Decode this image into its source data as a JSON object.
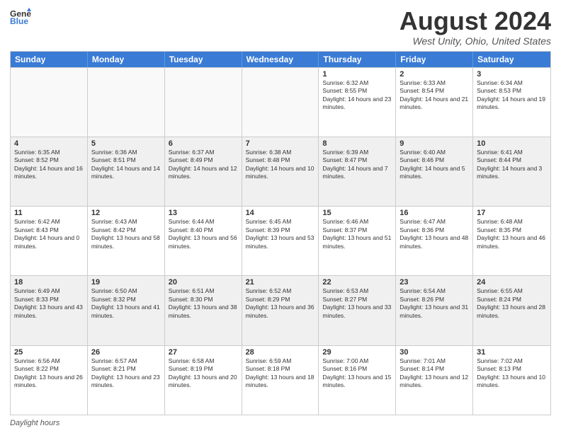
{
  "header": {
    "logo_line1": "General",
    "logo_line2": "Blue",
    "month_title": "August 2024",
    "location": "West Unity, Ohio, United States"
  },
  "weekdays": [
    "Sunday",
    "Monday",
    "Tuesday",
    "Wednesday",
    "Thursday",
    "Friday",
    "Saturday"
  ],
  "footer": {
    "label": "Daylight hours"
  },
  "weeks": [
    [
      {
        "day": "",
        "sunrise": "",
        "sunset": "",
        "daylight": "",
        "empty": true
      },
      {
        "day": "",
        "sunrise": "",
        "sunset": "",
        "daylight": "",
        "empty": true
      },
      {
        "day": "",
        "sunrise": "",
        "sunset": "",
        "daylight": "",
        "empty": true
      },
      {
        "day": "",
        "sunrise": "",
        "sunset": "",
        "daylight": "",
        "empty": true
      },
      {
        "day": "1",
        "sunrise": "Sunrise: 6:32 AM",
        "sunset": "Sunset: 8:55 PM",
        "daylight": "Daylight: 14 hours and 23 minutes."
      },
      {
        "day": "2",
        "sunrise": "Sunrise: 6:33 AM",
        "sunset": "Sunset: 8:54 PM",
        "daylight": "Daylight: 14 hours and 21 minutes."
      },
      {
        "day": "3",
        "sunrise": "Sunrise: 6:34 AM",
        "sunset": "Sunset: 8:53 PM",
        "daylight": "Daylight: 14 hours and 19 minutes."
      }
    ],
    [
      {
        "day": "4",
        "sunrise": "Sunrise: 6:35 AM",
        "sunset": "Sunset: 8:52 PM",
        "daylight": "Daylight: 14 hours and 16 minutes."
      },
      {
        "day": "5",
        "sunrise": "Sunrise: 6:36 AM",
        "sunset": "Sunset: 8:51 PM",
        "daylight": "Daylight: 14 hours and 14 minutes."
      },
      {
        "day": "6",
        "sunrise": "Sunrise: 6:37 AM",
        "sunset": "Sunset: 8:49 PM",
        "daylight": "Daylight: 14 hours and 12 minutes."
      },
      {
        "day": "7",
        "sunrise": "Sunrise: 6:38 AM",
        "sunset": "Sunset: 8:48 PM",
        "daylight": "Daylight: 14 hours and 10 minutes."
      },
      {
        "day": "8",
        "sunrise": "Sunrise: 6:39 AM",
        "sunset": "Sunset: 8:47 PM",
        "daylight": "Daylight: 14 hours and 7 minutes."
      },
      {
        "day": "9",
        "sunrise": "Sunrise: 6:40 AM",
        "sunset": "Sunset: 8:46 PM",
        "daylight": "Daylight: 14 hours and 5 minutes."
      },
      {
        "day": "10",
        "sunrise": "Sunrise: 6:41 AM",
        "sunset": "Sunset: 8:44 PM",
        "daylight": "Daylight: 14 hours and 3 minutes."
      }
    ],
    [
      {
        "day": "11",
        "sunrise": "Sunrise: 6:42 AM",
        "sunset": "Sunset: 8:43 PM",
        "daylight": "Daylight: 14 hours and 0 minutes."
      },
      {
        "day": "12",
        "sunrise": "Sunrise: 6:43 AM",
        "sunset": "Sunset: 8:42 PM",
        "daylight": "Daylight: 13 hours and 58 minutes."
      },
      {
        "day": "13",
        "sunrise": "Sunrise: 6:44 AM",
        "sunset": "Sunset: 8:40 PM",
        "daylight": "Daylight: 13 hours and 56 minutes."
      },
      {
        "day": "14",
        "sunrise": "Sunrise: 6:45 AM",
        "sunset": "Sunset: 8:39 PM",
        "daylight": "Daylight: 13 hours and 53 minutes."
      },
      {
        "day": "15",
        "sunrise": "Sunrise: 6:46 AM",
        "sunset": "Sunset: 8:37 PM",
        "daylight": "Daylight: 13 hours and 51 minutes."
      },
      {
        "day": "16",
        "sunrise": "Sunrise: 6:47 AM",
        "sunset": "Sunset: 8:36 PM",
        "daylight": "Daylight: 13 hours and 48 minutes."
      },
      {
        "day": "17",
        "sunrise": "Sunrise: 6:48 AM",
        "sunset": "Sunset: 8:35 PM",
        "daylight": "Daylight: 13 hours and 46 minutes."
      }
    ],
    [
      {
        "day": "18",
        "sunrise": "Sunrise: 6:49 AM",
        "sunset": "Sunset: 8:33 PM",
        "daylight": "Daylight: 13 hours and 43 minutes."
      },
      {
        "day": "19",
        "sunrise": "Sunrise: 6:50 AM",
        "sunset": "Sunset: 8:32 PM",
        "daylight": "Daylight: 13 hours and 41 minutes."
      },
      {
        "day": "20",
        "sunrise": "Sunrise: 6:51 AM",
        "sunset": "Sunset: 8:30 PM",
        "daylight": "Daylight: 13 hours and 38 minutes."
      },
      {
        "day": "21",
        "sunrise": "Sunrise: 6:52 AM",
        "sunset": "Sunset: 8:29 PM",
        "daylight": "Daylight: 13 hours and 36 minutes."
      },
      {
        "day": "22",
        "sunrise": "Sunrise: 6:53 AM",
        "sunset": "Sunset: 8:27 PM",
        "daylight": "Daylight: 13 hours and 33 minutes."
      },
      {
        "day": "23",
        "sunrise": "Sunrise: 6:54 AM",
        "sunset": "Sunset: 8:26 PM",
        "daylight": "Daylight: 13 hours and 31 minutes."
      },
      {
        "day": "24",
        "sunrise": "Sunrise: 6:55 AM",
        "sunset": "Sunset: 8:24 PM",
        "daylight": "Daylight: 13 hours and 28 minutes."
      }
    ],
    [
      {
        "day": "25",
        "sunrise": "Sunrise: 6:56 AM",
        "sunset": "Sunset: 8:22 PM",
        "daylight": "Daylight: 13 hours and 26 minutes."
      },
      {
        "day": "26",
        "sunrise": "Sunrise: 6:57 AM",
        "sunset": "Sunset: 8:21 PM",
        "daylight": "Daylight: 13 hours and 23 minutes."
      },
      {
        "day": "27",
        "sunrise": "Sunrise: 6:58 AM",
        "sunset": "Sunset: 8:19 PM",
        "daylight": "Daylight: 13 hours and 20 minutes."
      },
      {
        "day": "28",
        "sunrise": "Sunrise: 6:59 AM",
        "sunset": "Sunset: 8:18 PM",
        "daylight": "Daylight: 13 hours and 18 minutes."
      },
      {
        "day": "29",
        "sunrise": "Sunrise: 7:00 AM",
        "sunset": "Sunset: 8:16 PM",
        "daylight": "Daylight: 13 hours and 15 minutes."
      },
      {
        "day": "30",
        "sunrise": "Sunrise: 7:01 AM",
        "sunset": "Sunset: 8:14 PM",
        "daylight": "Daylight: 13 hours and 12 minutes."
      },
      {
        "day": "31",
        "sunrise": "Sunrise: 7:02 AM",
        "sunset": "Sunset: 8:13 PM",
        "daylight": "Daylight: 13 hours and 10 minutes."
      }
    ]
  ]
}
